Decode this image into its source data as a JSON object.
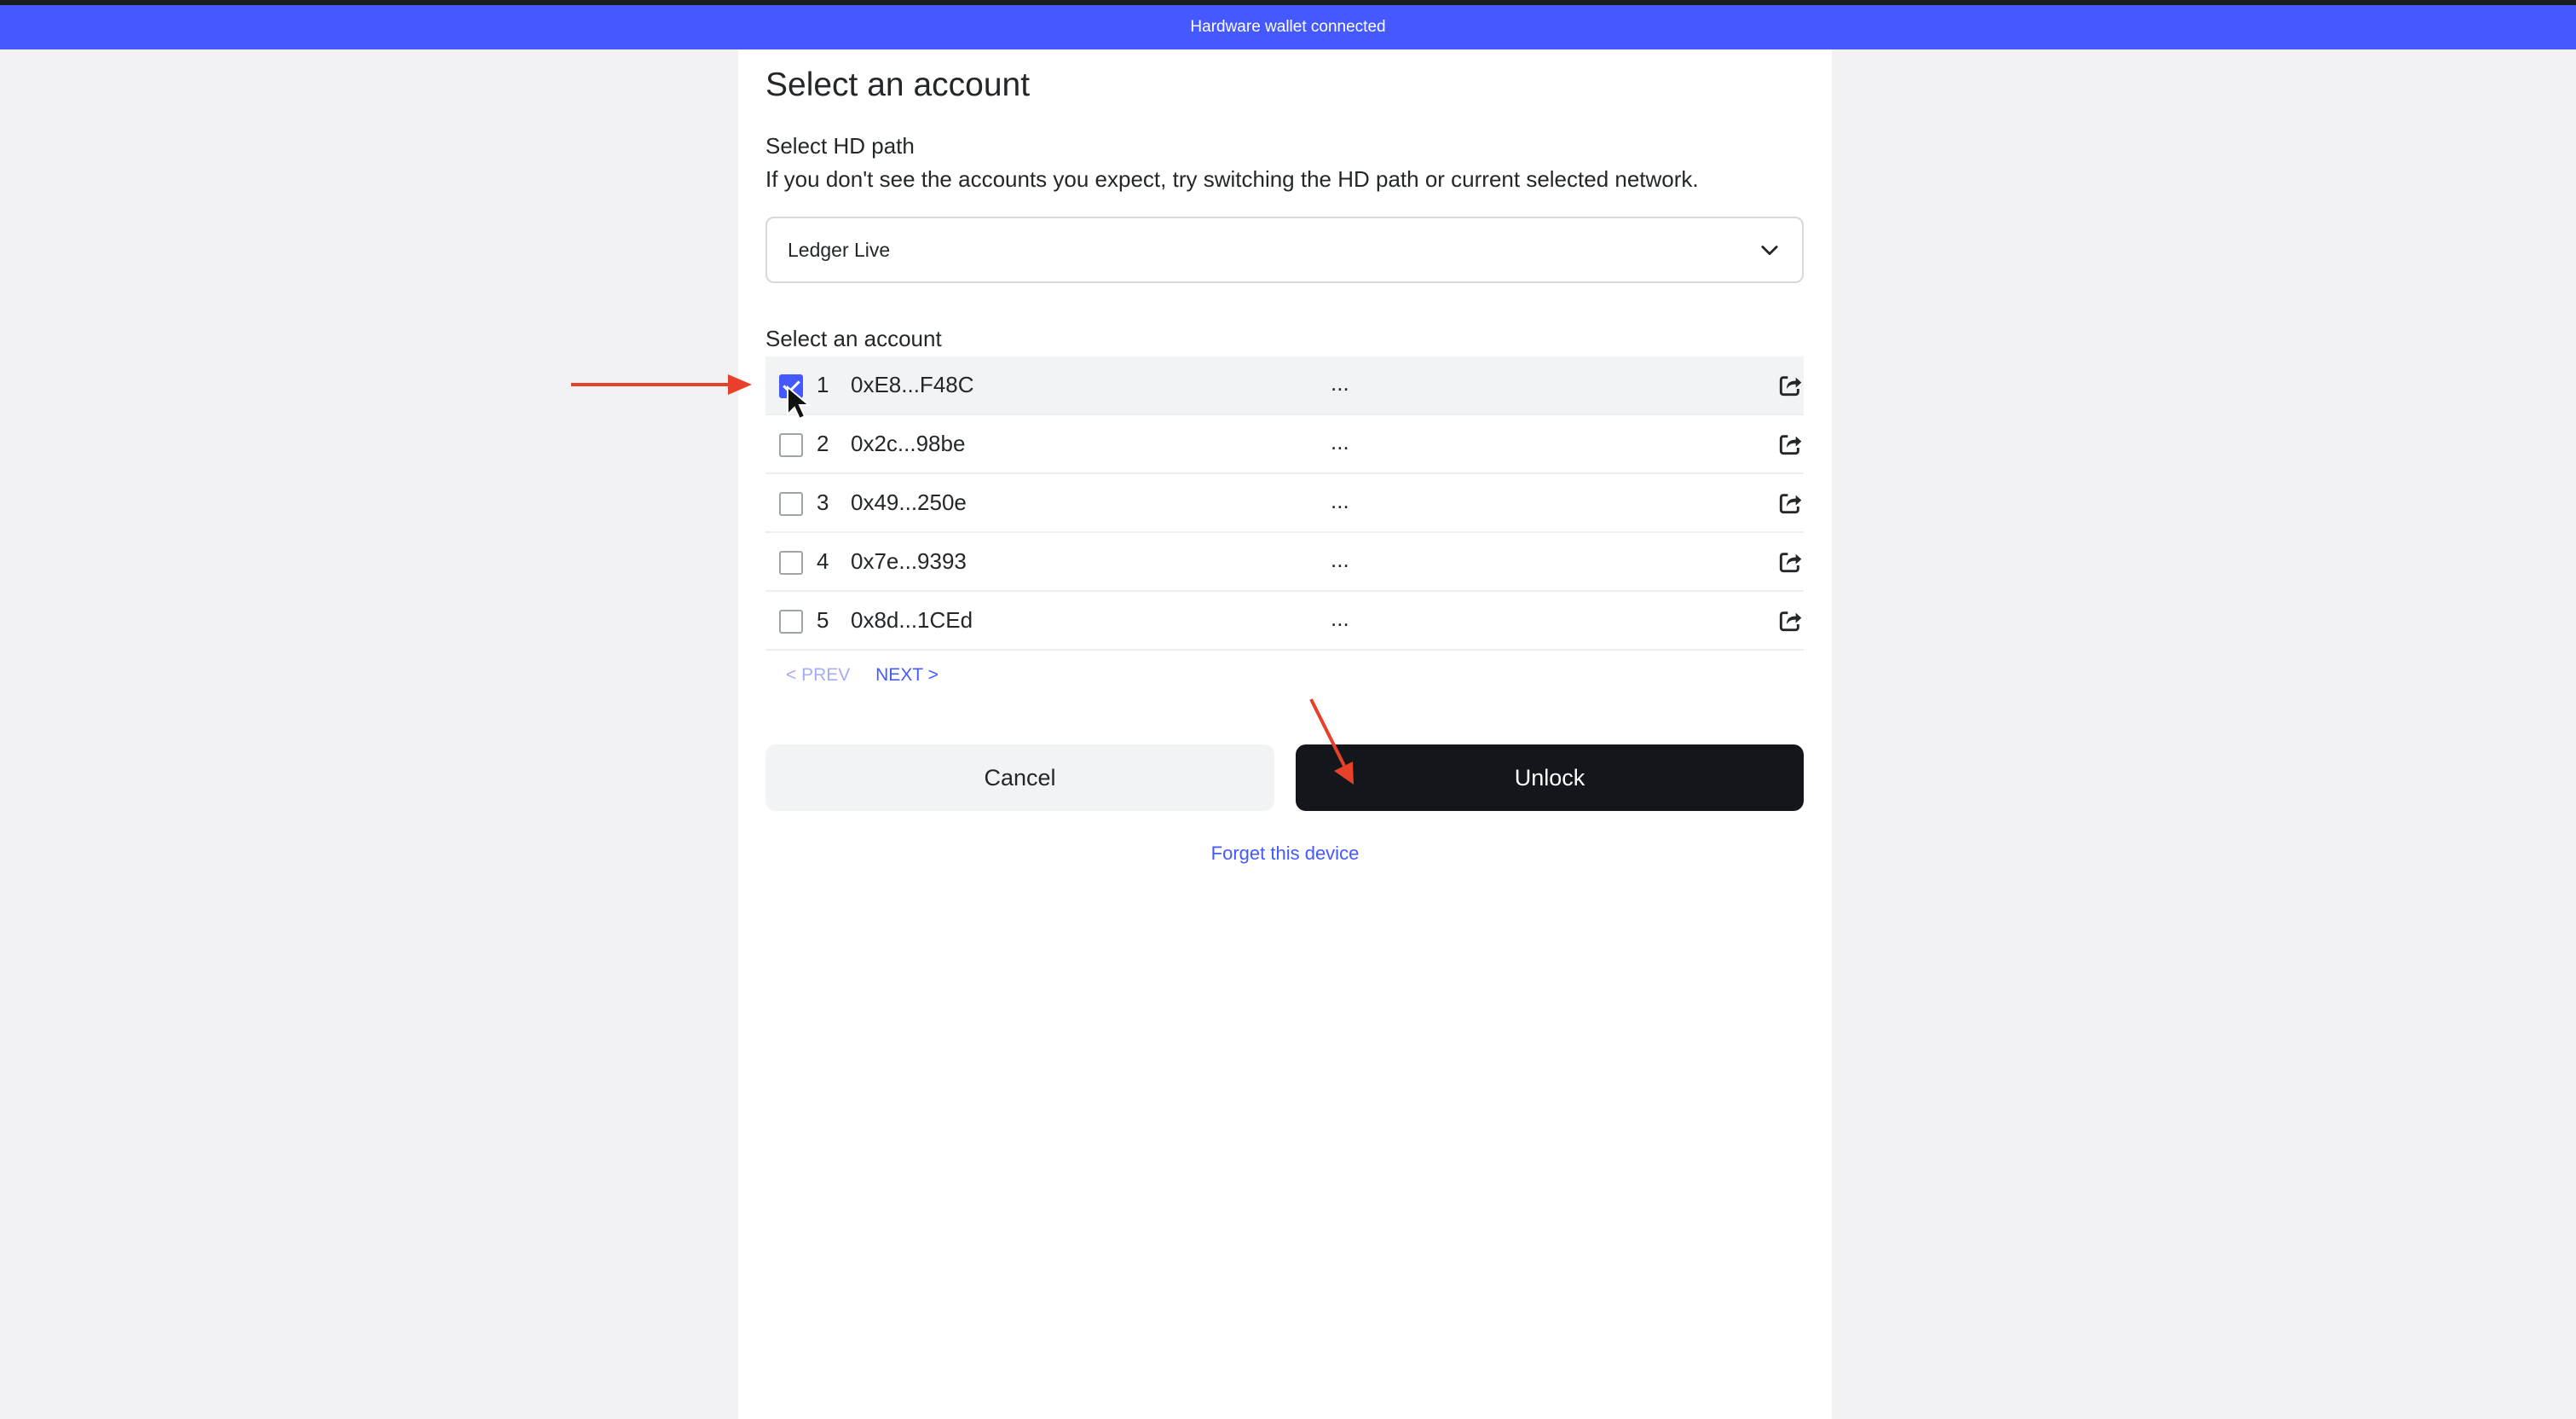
{
  "banner": {
    "text": "Hardware wallet connected",
    "color": "#4459ff"
  },
  "dialog": {
    "title": "Select an account",
    "hd_path": {
      "label": "Select HD path",
      "description": "If you don't see the accounts you expect, try switching the HD path or current selected network.",
      "selected": "Ledger Live",
      "icon": "chevron-down-icon"
    },
    "accounts_label": "Select an account",
    "accounts": [
      {
        "index": "1",
        "address": "0xE8...F48C",
        "balance": "...",
        "checked": true
      },
      {
        "index": "2",
        "address": "0x2c...98be",
        "balance": "...",
        "checked": false
      },
      {
        "index": "3",
        "address": "0x49...250e",
        "balance": "...",
        "checked": false
      },
      {
        "index": "4",
        "address": "0x7e...9393",
        "balance": "...",
        "checked": false
      },
      {
        "index": "5",
        "address": "0x8d...1CEd",
        "balance": "...",
        "checked": false
      }
    ],
    "pagination": {
      "prev": "< PREV",
      "next": "NEXT >"
    },
    "cancel_label": "Cancel",
    "unlock_label": "Unlock",
    "forget_label": "Forget this device"
  },
  "colors": {
    "accent": "#4459ff",
    "primary_button": "#13171c",
    "annotation_arrow": "#e8402a",
    "page_background": "#f2f2f4"
  }
}
